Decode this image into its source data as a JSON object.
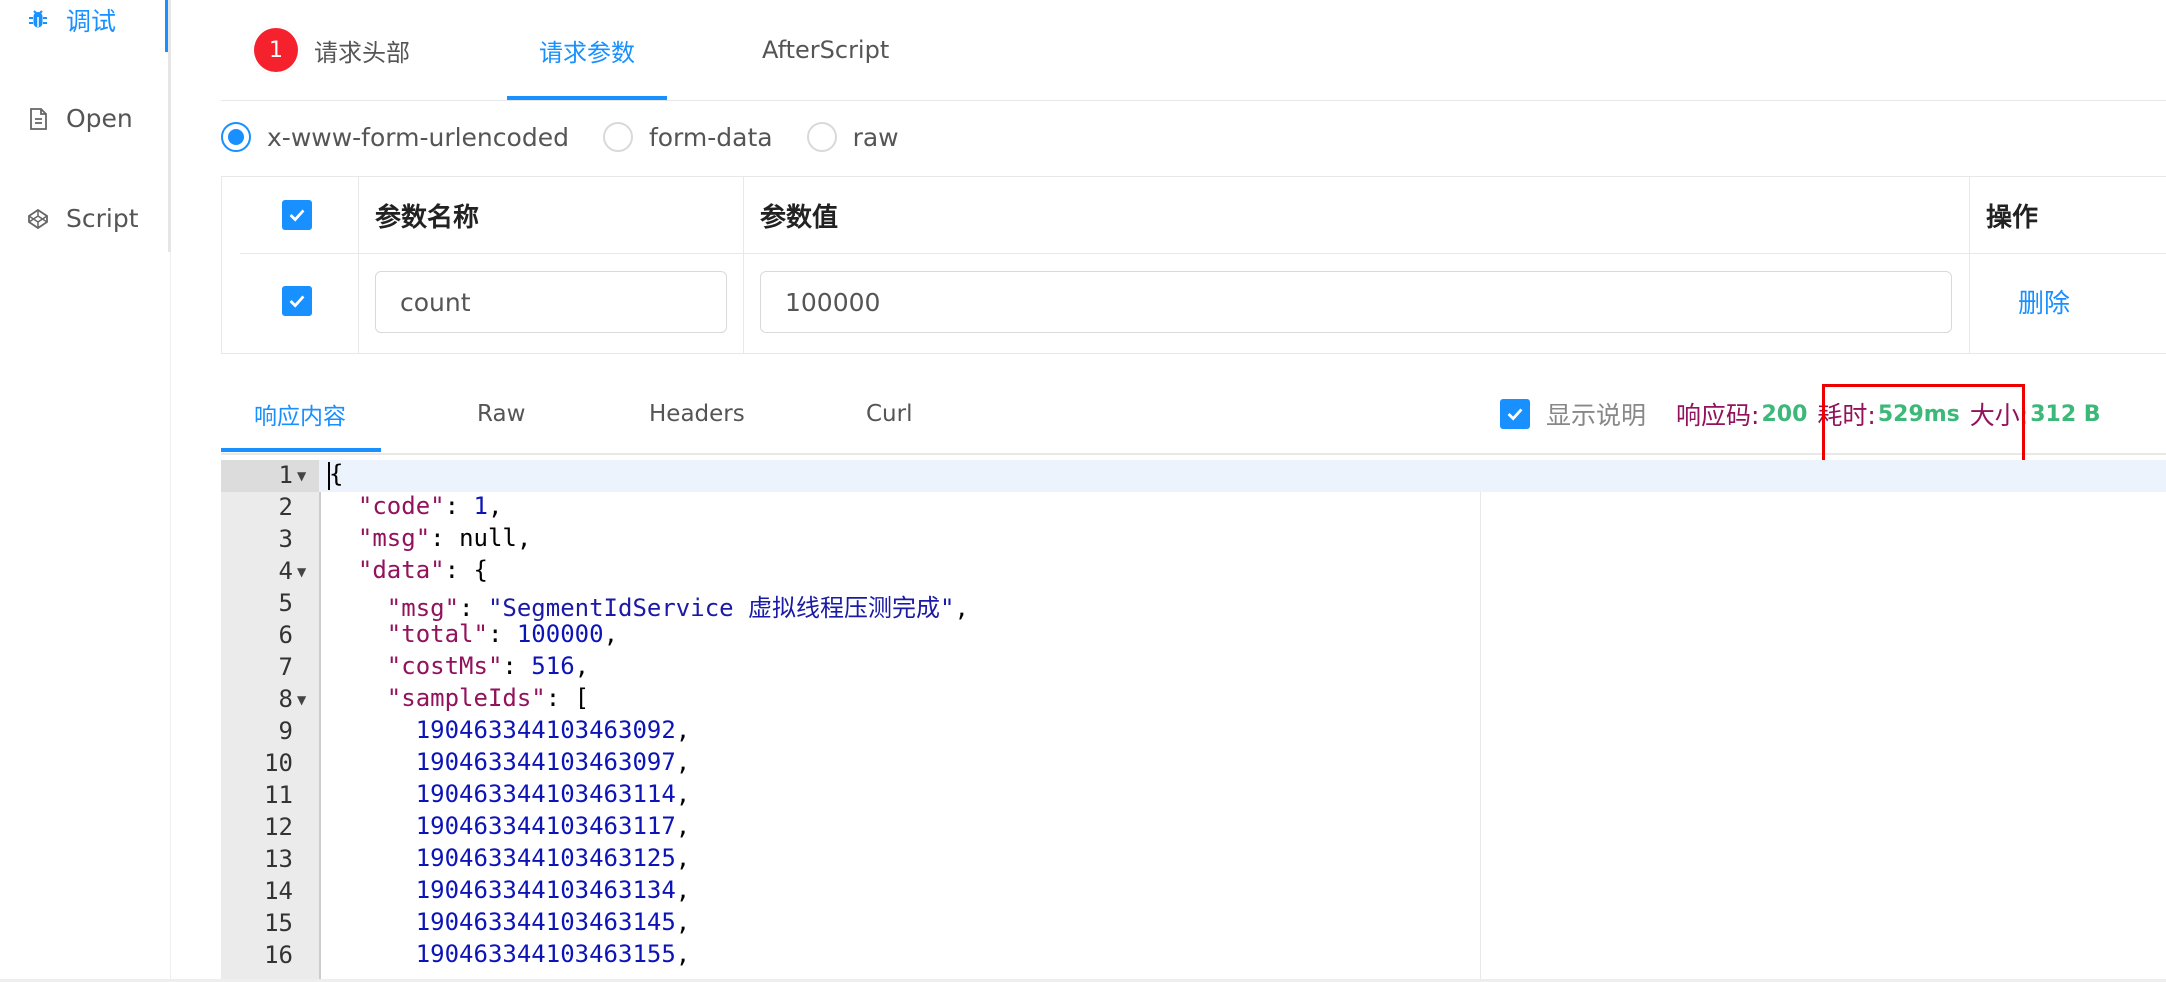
{
  "sidebar": {
    "items": [
      {
        "label": "调试",
        "icon": "bug-icon",
        "active": true
      },
      {
        "label": "Open",
        "icon": "document-icon"
      },
      {
        "label": "Script",
        "icon": "codepen-icon"
      }
    ]
  },
  "tabs": {
    "badge": "1",
    "items": [
      {
        "label": "请求头部"
      },
      {
        "label": "请求参数",
        "active": true
      },
      {
        "label": "AfterScript"
      }
    ]
  },
  "body_types": {
    "options": [
      {
        "label": "x-www-form-urlencoded",
        "checked": true
      },
      {
        "label": "form-data",
        "checked": false
      },
      {
        "label": "raw",
        "checked": false
      }
    ]
  },
  "params_table": {
    "headers": {
      "name": "参数名称",
      "value": "参数值",
      "action": "操作"
    },
    "rows": [
      {
        "name": "count",
        "value": "100000",
        "action": "删除",
        "checked": true
      }
    ]
  },
  "response": {
    "tabs": [
      {
        "label": "响应内容",
        "active": true
      },
      {
        "label": "Raw"
      },
      {
        "label": "Headers"
      },
      {
        "label": "Curl"
      }
    ],
    "show_desc_label": "显示说明",
    "show_desc_checked": true,
    "status_code_label": "响应码:",
    "status_code": "200",
    "time_label": "耗时:",
    "time": "529ms",
    "size_label": "大小:",
    "size": "312 B",
    "status_color": "#3cb878"
  },
  "editor": {
    "lines": [
      {
        "n": "1",
        "fold": true
      },
      {
        "n": "2"
      },
      {
        "n": "3"
      },
      {
        "n": "4",
        "fold": true
      },
      {
        "n": "5"
      },
      {
        "n": "6"
      },
      {
        "n": "7"
      },
      {
        "n": "8",
        "fold": true
      },
      {
        "n": "9"
      },
      {
        "n": "10"
      },
      {
        "n": "11"
      },
      {
        "n": "12"
      },
      {
        "n": "13"
      },
      {
        "n": "14"
      },
      {
        "n": "15"
      },
      {
        "n": "16"
      }
    ],
    "json": {
      "code_key": "\"code\"",
      "code_val": "1",
      "msg_key": "\"msg\"",
      "msg_val": "null",
      "data_key": "\"data\"",
      "data_msg_key": "\"msg\"",
      "data_msg_val": "\"SegmentIdService 虚拟线程压测完成\"",
      "total_key": "\"total\"",
      "total_val": "100000",
      "cost_key": "\"costMs\"",
      "cost_val": "516",
      "sample_key": "\"sampleIds\"",
      "ids": [
        "190463344103463092",
        "190463344103463097",
        "190463344103463114",
        "190463344103463117",
        "190463344103463125",
        "190463344103463134",
        "190463344103463145",
        "190463344103463155"
      ]
    }
  }
}
